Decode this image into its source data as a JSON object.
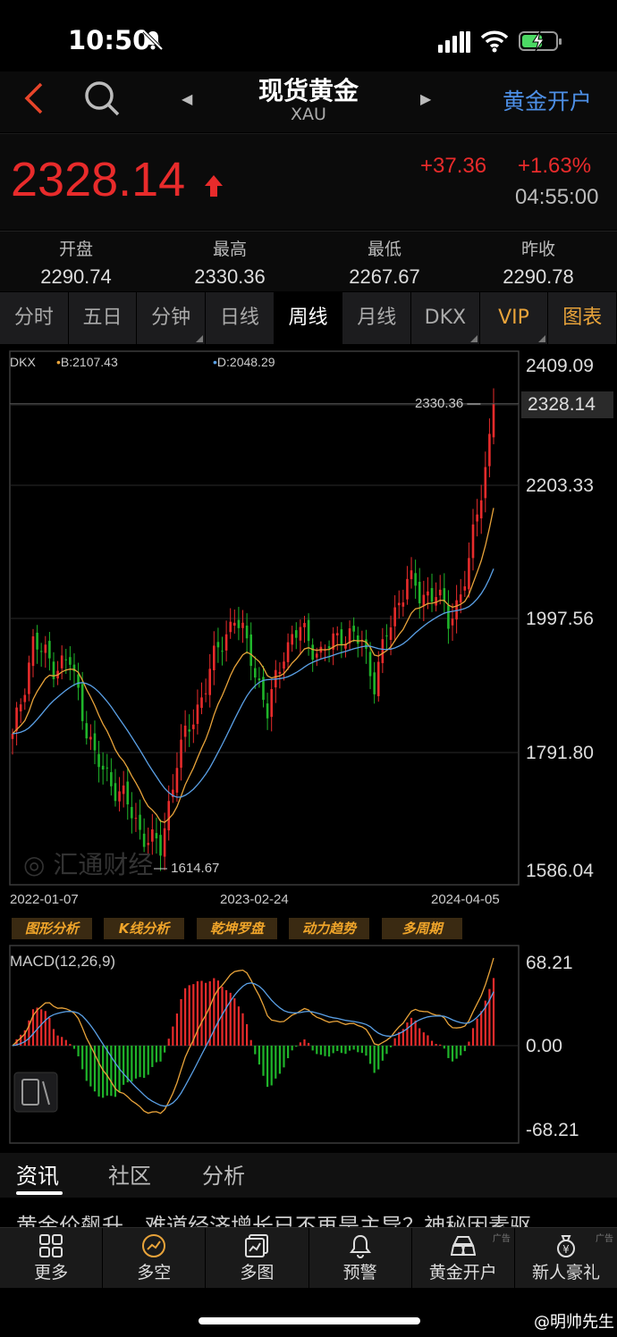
{
  "status": {
    "time": "10:50"
  },
  "nav": {
    "title": "现货黄金",
    "subtitle": "XAU",
    "open_account": "黄金开户"
  },
  "quote": {
    "price": "2328.14",
    "change": "+37.36",
    "change_pct": "+1.63%",
    "time": "04:55:00",
    "price_color": "#e82b2b"
  },
  "stats": [
    {
      "label": "开盘",
      "value": "2290.74"
    },
    {
      "label": "最高",
      "value": "2330.36"
    },
    {
      "label": "最低",
      "value": "2267.67"
    },
    {
      "label": "昨收",
      "value": "2290.78"
    }
  ],
  "tabs": [
    "分时",
    "五日",
    "分钟",
    "日线",
    "周线",
    "月线",
    "DKX",
    "VIP",
    "图表"
  ],
  "active_tab": "周线",
  "chart": {
    "legend_name": "DKX",
    "legend_b": "B:2107.43",
    "legend_d": "D:2048.29",
    "y_ticks": [
      "2409.09",
      "2203.33",
      "1997.56",
      "1791.80",
      "1586.04"
    ],
    "current_price_label": "2328.14",
    "high_label": "2330.36",
    "low_label": "1614.67",
    "x_labels": [
      "2022-01-07",
      "2023-02-24",
      "2024-04-05"
    ],
    "watermark": "汇通财经",
    "analysis_buttons": [
      "图形分析",
      "K线分析",
      "乾坤罗盘",
      "动力趋势",
      "多周期"
    ],
    "macd_label": "MACD(12,26,9)",
    "macd_ticks": [
      "68.21",
      "0.00",
      "-68.21"
    ]
  },
  "chart_data": {
    "type": "candlestick",
    "title": "现货黄金 XAU 周线",
    "x_range": [
      "2022-01-07",
      "2024-04-05"
    ],
    "ylim": [
      1586.04,
      2409.09
    ],
    "y_ticks": [
      2409.09,
      2203.33,
      1997.56,
      1791.8,
      1586.04
    ],
    "period_high": 2330.36,
    "period_low": 1614.67,
    "last": 2328.14,
    "series": [
      {
        "name": "B",
        "last_value": 2107.43,
        "color": "#e8a33a"
      },
      {
        "name": "D",
        "last_value": 2048.29,
        "color": "#5aa0e6"
      }
    ],
    "macd": {
      "params": "12,26,9",
      "ylim": [
        -68.21,
        68.21
      ]
    },
    "up_color": "#e82b2b",
    "down_color": "#1fb52a"
  },
  "content_tabs": [
    "资讯",
    "社区",
    "分析"
  ],
  "news_headline": "黄金价飙升，难道经济增长已不再是主导？神秘因素驱",
  "bottom_bar": [
    {
      "label": "更多",
      "icon": "grid-icon"
    },
    {
      "label": "多空",
      "icon": "trend-circle-icon"
    },
    {
      "label": "多图",
      "icon": "multi-chart-icon"
    },
    {
      "label": "预警",
      "icon": "bell-icon"
    },
    {
      "label": "黄金开户",
      "icon": "gold-bars-icon",
      "ad": "广告"
    },
    {
      "label": "新人豪礼",
      "icon": "money-bag-icon",
      "ad": "广告"
    }
  ],
  "watermark_user": "@明帅先生"
}
